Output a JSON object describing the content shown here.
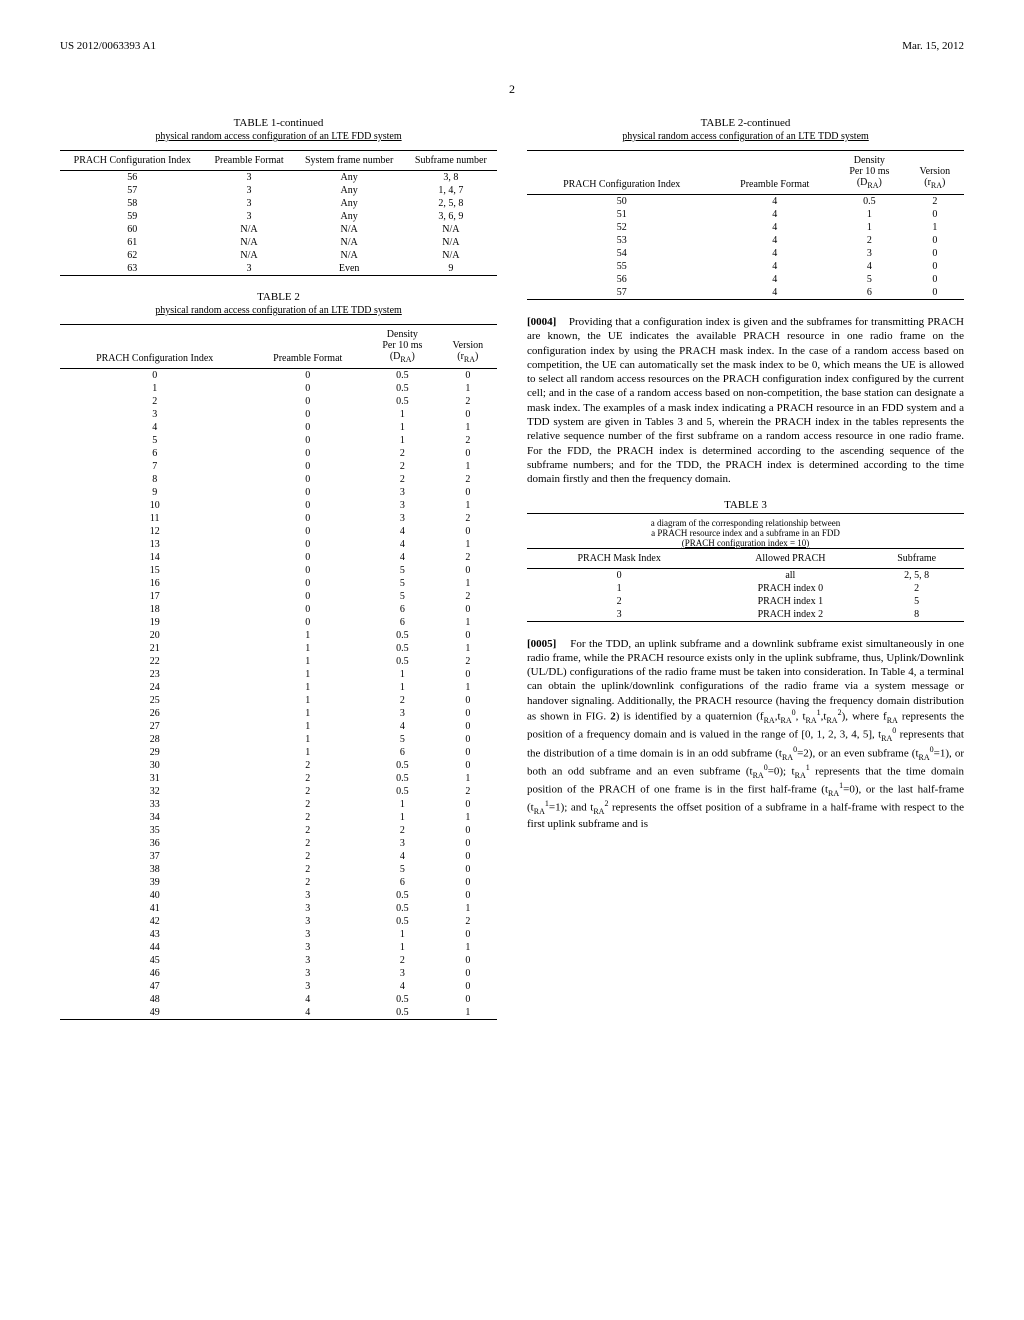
{
  "header": {
    "patent_id": "US 2012/0063393 A1",
    "date": "Mar. 15, 2012",
    "page": "2"
  },
  "table1_cont": {
    "title": "TABLE 1-continued",
    "caption": "physical random access configuration of an LTE FDD system",
    "headers": [
      "PRACH Configuration Index",
      "Preamble Format",
      "System frame number",
      "Subframe number"
    ],
    "rows": [
      [
        "56",
        "3",
        "Any",
        "3, 8"
      ],
      [
        "57",
        "3",
        "Any",
        "1, 4, 7"
      ],
      [
        "58",
        "3",
        "Any",
        "2, 5, 8"
      ],
      [
        "59",
        "3",
        "Any",
        "3, 6, 9"
      ],
      [
        "60",
        "N/A",
        "N/A",
        "N/A"
      ],
      [
        "61",
        "N/A",
        "N/A",
        "N/A"
      ],
      [
        "62",
        "N/A",
        "N/A",
        "N/A"
      ],
      [
        "63",
        "3",
        "Even",
        "9"
      ]
    ]
  },
  "table2": {
    "title": "TABLE 2",
    "caption": "physical random access configuration of an LTE TDD system",
    "headers": [
      "PRACH Configuration Index",
      "Preamble Format",
      "Density Per 10 ms (D_RA)",
      "Version (r_RA)"
    ],
    "rows": [
      [
        "0",
        "0",
        "0.5",
        "0"
      ],
      [
        "1",
        "0",
        "0.5",
        "1"
      ],
      [
        "2",
        "0",
        "0.5",
        "2"
      ],
      [
        "3",
        "0",
        "1",
        "0"
      ],
      [
        "4",
        "0",
        "1",
        "1"
      ],
      [
        "5",
        "0",
        "1",
        "2"
      ],
      [
        "6",
        "0",
        "2",
        "0"
      ],
      [
        "7",
        "0",
        "2",
        "1"
      ],
      [
        "8",
        "0",
        "2",
        "2"
      ],
      [
        "9",
        "0",
        "3",
        "0"
      ],
      [
        "10",
        "0",
        "3",
        "1"
      ],
      [
        "11",
        "0",
        "3",
        "2"
      ],
      [
        "12",
        "0",
        "4",
        "0"
      ],
      [
        "13",
        "0",
        "4",
        "1"
      ],
      [
        "14",
        "0",
        "4",
        "2"
      ],
      [
        "15",
        "0",
        "5",
        "0"
      ],
      [
        "16",
        "0",
        "5",
        "1"
      ],
      [
        "17",
        "0",
        "5",
        "2"
      ],
      [
        "18",
        "0",
        "6",
        "0"
      ],
      [
        "19",
        "0",
        "6",
        "1"
      ],
      [
        "20",
        "1",
        "0.5",
        "0"
      ],
      [
        "21",
        "1",
        "0.5",
        "1"
      ],
      [
        "22",
        "1",
        "0.5",
        "2"
      ],
      [
        "23",
        "1",
        "1",
        "0"
      ],
      [
        "24",
        "1",
        "1",
        "1"
      ],
      [
        "25",
        "1",
        "2",
        "0"
      ],
      [
        "26",
        "1",
        "3",
        "0"
      ],
      [
        "27",
        "1",
        "4",
        "0"
      ],
      [
        "28",
        "1",
        "5",
        "0"
      ],
      [
        "29",
        "1",
        "6",
        "0"
      ],
      [
        "30",
        "2",
        "0.5",
        "0"
      ],
      [
        "31",
        "2",
        "0.5",
        "1"
      ],
      [
        "32",
        "2",
        "0.5",
        "2"
      ],
      [
        "33",
        "2",
        "1",
        "0"
      ],
      [
        "34",
        "2",
        "1",
        "1"
      ],
      [
        "35",
        "2",
        "2",
        "0"
      ],
      [
        "36",
        "2",
        "3",
        "0"
      ],
      [
        "37",
        "2",
        "4",
        "0"
      ],
      [
        "38",
        "2",
        "5",
        "0"
      ],
      [
        "39",
        "2",
        "6",
        "0"
      ],
      [
        "40",
        "3",
        "0.5",
        "0"
      ],
      [
        "41",
        "3",
        "0.5",
        "1"
      ],
      [
        "42",
        "3",
        "0.5",
        "2"
      ],
      [
        "43",
        "3",
        "1",
        "0"
      ],
      [
        "44",
        "3",
        "1",
        "1"
      ],
      [
        "45",
        "3",
        "2",
        "0"
      ],
      [
        "46",
        "3",
        "3",
        "0"
      ],
      [
        "47",
        "3",
        "4",
        "0"
      ],
      [
        "48",
        "4",
        "0.5",
        "0"
      ],
      [
        "49",
        "4",
        "0.5",
        "1"
      ]
    ]
  },
  "table2_cont": {
    "title": "TABLE 2-continued",
    "caption": "physical random access configuration of an LTE TDD system",
    "headers": [
      "PRACH Configuration Index",
      "Preamble Format",
      "Density Per 10 ms (D_RA)",
      "Version (r_RA)"
    ],
    "rows": [
      [
        "50",
        "4",
        "0.5",
        "2"
      ],
      [
        "51",
        "4",
        "1",
        "0"
      ],
      [
        "52",
        "4",
        "1",
        "1"
      ],
      [
        "53",
        "4",
        "2",
        "0"
      ],
      [
        "54",
        "4",
        "3",
        "0"
      ],
      [
        "55",
        "4",
        "4",
        "0"
      ],
      [
        "56",
        "4",
        "5",
        "0"
      ],
      [
        "57",
        "4",
        "6",
        "0"
      ]
    ]
  },
  "para4": {
    "num": "[0004]",
    "text": "Providing that a configuration index is given and the subframes for transmitting PRACH are known, the UE indicates the available PRACH resource in one radio frame on the configuration index by using the PRACH mask index. In the case of a random access based on competition, the UE can automatically set the mask index to be 0, which means the UE is allowed to select all random access resources on the PRACH configuration index configured by the current cell; and in the case of a random access based on non-competition, the base station can designate a mask index. The examples of a mask index indicating a PRACH resource in an FDD system and a TDD system are given in Tables 3 and 5, wherein the PRACH index in the tables represents the relative sequence number of the first subframe on a random access resource in one radio frame. For the FDD, the PRACH index is determined according to the ascending sequence of the subframe numbers; and for the TDD, the PRACH index is determined according to the time domain firstly and then the frequency domain."
  },
  "table3": {
    "title": "TABLE 3",
    "caption_line1": "a diagram of the corresponding relationship between",
    "caption_line2": "a PRACH resource index and a subframe in an FDD",
    "caption_line3": "(PRACH configuration index = 10)",
    "headers": [
      "PRACH Mask Index",
      "Allowed PRACH",
      "Subframe"
    ],
    "rows": [
      [
        "0",
        "all",
        "2, 5, 8"
      ],
      [
        "1",
        "PRACH index 0",
        "2"
      ],
      [
        "2",
        "PRACH index 1",
        "5"
      ],
      [
        "3",
        "PRACH index 2",
        "8"
      ]
    ]
  },
  "para5": {
    "num": "[0005]",
    "text_prefix": "For the TDD, an uplink subframe and a downlink subframe exist simultaneously in one radio frame, while the PRACH resource exists only in the uplink subframe, thus, Uplink/Downlink (UL/DL) configurations of the radio frame must be taken into consideration. In Table 4, a terminal can obtain the uplink/downlink configurations of the radio frame via a system message or handover signaling. Additionally, the PRACH resource (having the frequency domain distribution as shown in FIG. "
  }
}
